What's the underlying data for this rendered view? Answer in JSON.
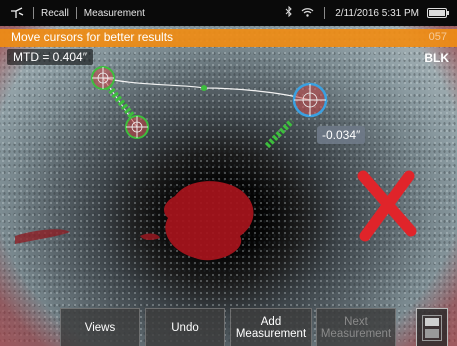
{
  "statusbar": {
    "app_icon": "probe-logo-icon",
    "recall_label": "Recall",
    "mode_label": "Measurement",
    "bluetooth_icon": "bluetooth-icon",
    "wifi_icon": "wifi-icon",
    "datetime": "2/11/2016 5:31 PM",
    "battery_icon": "battery-icon"
  },
  "banner": {
    "message": "Move cursors for better results",
    "number": "057"
  },
  "measurement": {
    "mtd_label": "MTD = 0.404″",
    "color_mode": "BLK",
    "depth_value": "-0.034″"
  },
  "colors": {
    "banner": "#f08c14",
    "cursor_green": "#3dbe3d",
    "cursor_blue": "#3aa0e0",
    "invalid_x": "#e0242a"
  },
  "toolbar": {
    "views_label": "Views",
    "undo_label": "Undo",
    "add_label_1": "Add",
    "add_label_2": "Measurement",
    "next_label_1": "Next",
    "next_label_2": "Measurement"
  }
}
